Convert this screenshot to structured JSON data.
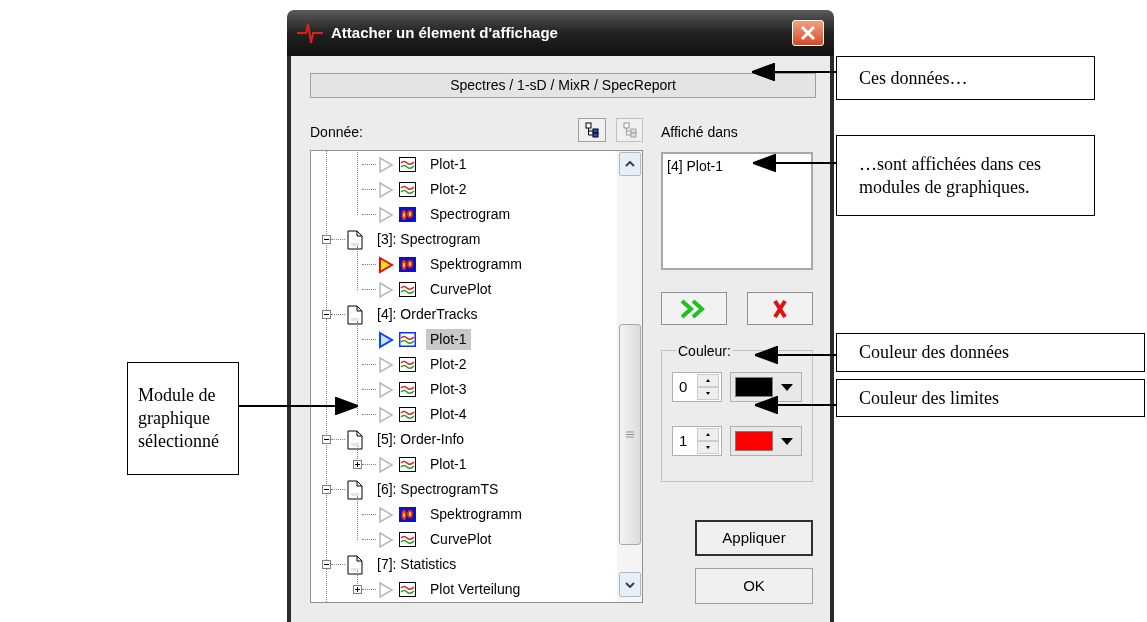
{
  "window": {
    "title": "Attacher un élement d'affichage"
  },
  "path": "Spectres / 1-sD / MixR / SpecReport",
  "data_label": "Donnée:",
  "tree": [
    {
      "children": [
        {
          "label": "Plot-1",
          "kind": "plot",
          "active": false,
          "selected": false
        },
        {
          "label": "Plot-2",
          "kind": "plot",
          "active": false,
          "selected": false
        },
        {
          "label": "Spectrogram",
          "kind": "spectrogram",
          "active": false,
          "selected": false
        }
      ]
    },
    {
      "label": "[3]: Spectrogram",
      "kind": "document",
      "expanded": true,
      "selected": false,
      "children": [
        {
          "label": "Spektrogramm",
          "kind": "spectrogram",
          "active": true,
          "selected": false
        },
        {
          "label": "CurvePlot",
          "kind": "plot",
          "active": false,
          "selected": false
        }
      ]
    },
    {
      "label": "[4]: OrderTracks",
      "kind": "document",
      "expanded": true,
      "selected": false,
      "children": [
        {
          "label": "Plot-1",
          "kind": "plot",
          "active": false,
          "selected": true
        },
        {
          "label": "Plot-2",
          "kind": "plot",
          "active": false,
          "selected": false
        },
        {
          "label": "Plot-3",
          "kind": "plot",
          "active": false,
          "selected": false
        },
        {
          "label": "Plot-4",
          "kind": "plot",
          "active": false,
          "selected": false
        }
      ]
    },
    {
      "label": "[5]: Order-Info",
      "kind": "document",
      "expanded": true,
      "selected": false,
      "children": [
        {
          "label": "Plot-1",
          "kind": "plot",
          "active": false,
          "selected": false,
          "expanded": false
        }
      ]
    },
    {
      "label": "[6]: SpectrogramTS",
      "kind": "document",
      "expanded": true,
      "selected": false,
      "children": [
        {
          "label": "Spektrogramm",
          "kind": "spectrogram",
          "active": false,
          "selected": false
        },
        {
          "label": "CurvePlot",
          "kind": "plot",
          "active": false,
          "selected": false
        }
      ]
    },
    {
      "label": "[7]: Statistics",
      "kind": "document",
      "expanded": true,
      "selected": false,
      "children": [
        {
          "label": "Plot Verteilung",
          "kind": "plot",
          "active": false,
          "selected": false,
          "expanded": false
        }
      ]
    }
  ],
  "shown_in": {
    "label": "Affiché dans",
    "items": [
      "[4] Plot-1"
    ]
  },
  "color_group": {
    "label": "Couleur:",
    "rows": [
      {
        "index": "0",
        "color": "#000000"
      },
      {
        "index": "1",
        "color": "#ff0000"
      }
    ]
  },
  "buttons": [
    "Appliquer",
    "OK"
  ],
  "callouts": [
    {
      "text": "Ces données…"
    },
    {
      "text": "…sont affichées dans ces modules de graphiques."
    },
    {
      "text": "Couleur des données"
    },
    {
      "text": "Module de graphique sélectionné"
    },
    {
      "text": "Couleur des limites"
    }
  ]
}
